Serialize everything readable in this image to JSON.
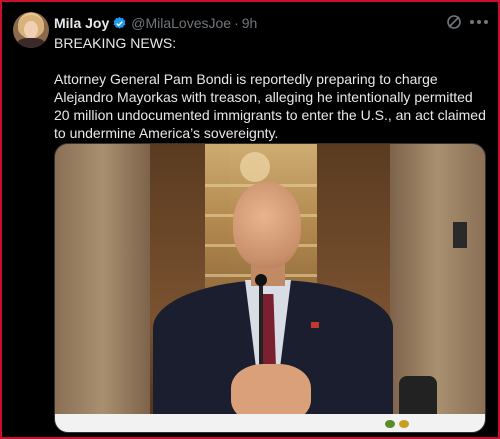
{
  "author": {
    "name": "Mila Joy",
    "handle": "@MilaLovesJoe",
    "separator": "·",
    "time": "9h",
    "verified": true
  },
  "tweet": {
    "headline": "BREAKING NEWS:",
    "body": "Attorney General Pam Bondi is reportedly preparing to charge Alejandro Mayorkas with treason, alleging he intentionally permitted 20 million undocumented immigrants to enter the U.S., an act claimed to undermine America’s sovereignty."
  },
  "icons": {
    "grok": "grok-icon",
    "more": "more-icon",
    "verified": "verified-badge-icon"
  },
  "colors": {
    "background": "#000000",
    "text": "#e7e9ea",
    "secondary": "#71767b",
    "verified": "#1d9bf0",
    "frame_border": "#c8102e"
  }
}
